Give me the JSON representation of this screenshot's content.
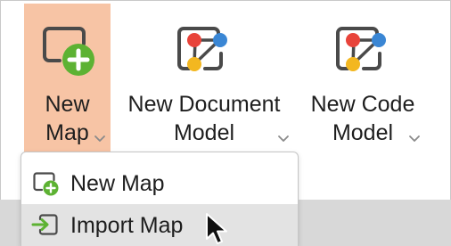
{
  "ribbon": {
    "new_map": {
      "line1": "New",
      "line2": "Map"
    },
    "new_document_model": {
      "line1": "New Document",
      "line2": "Model"
    },
    "new_code_model": {
      "line1": "New Code",
      "line2": "Model"
    }
  },
  "dropdown": {
    "items": [
      {
        "label": "New Map",
        "icon": "new-map-icon"
      },
      {
        "label": "Import Map",
        "icon": "import-icon"
      }
    ]
  },
  "colors": {
    "active_highlight": "#f7c4a5",
    "green_accent": "#5db233",
    "node_red": "#e8433a",
    "node_blue": "#3a86d4",
    "node_yellow": "#f3b720",
    "hover_row": "#e3e3e3"
  }
}
